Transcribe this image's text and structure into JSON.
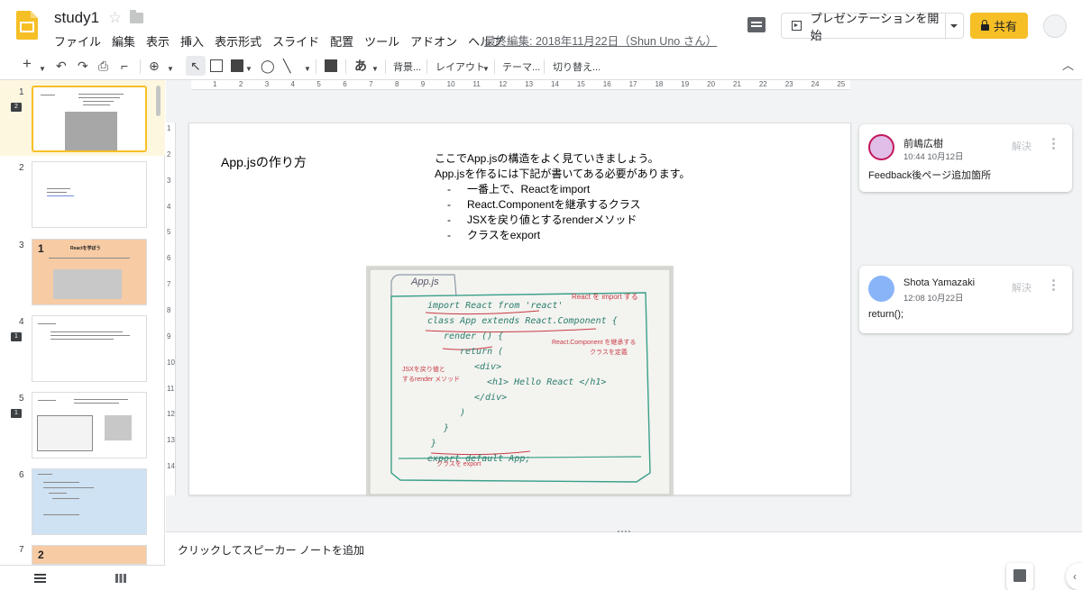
{
  "header": {
    "doc_title": "study1",
    "menu": [
      "ファイル",
      "編集",
      "表示",
      "挿入",
      "表示形式",
      "スライド",
      "配置",
      "ツール",
      "アドオン",
      "ヘルプ"
    ],
    "last_edit": "最終編集: 2018年11月22日（Shun Uno さん）",
    "present_label": "プレゼンテーションを開始",
    "share_label": "共有",
    "accent_color": "#f6bf26"
  },
  "toolbar": {
    "background_label": "背景...",
    "layout_label": "レイアウト",
    "theme_label": "テーマ...",
    "transition_label": "切り替え...",
    "text_style_glyph": "あ"
  },
  "filmstrip": {
    "slides": [
      {
        "num": "1",
        "comments": "2",
        "style": "white"
      },
      {
        "num": "2",
        "comments": "",
        "style": "white"
      },
      {
        "num": "3",
        "comments": "",
        "style": "orange"
      },
      {
        "num": "4",
        "comments": "1",
        "style": "white"
      },
      {
        "num": "5",
        "comments": "1",
        "style": "white"
      },
      {
        "num": "6",
        "comments": "",
        "style": "blue"
      },
      {
        "num": "7",
        "comments": "",
        "style": "orange"
      }
    ],
    "thumb_3_number": "1",
    "thumb_3_title": "Reactを学ぼう",
    "thumb_7_number": "2"
  },
  "ruler": {
    "h_ticks": [
      "1",
      "2",
      "3",
      "4",
      "5",
      "6",
      "7",
      "8",
      "9",
      "10",
      "11",
      "12",
      "13",
      "14",
      "15",
      "16",
      "17",
      "18",
      "19",
      "20",
      "21",
      "22",
      "23",
      "24",
      "25"
    ],
    "v_ticks": [
      "1",
      "2",
      "3",
      "4",
      "5",
      "6",
      "7",
      "8",
      "9",
      "10",
      "11",
      "12",
      "13",
      "14"
    ]
  },
  "slide": {
    "title": "App.jsの作り方",
    "intro_1": "ここでApp.jsの構造をよく見ていきましょう。",
    "intro_2": "App.jsを作るには下記が書いてある必要があります。",
    "bullets": [
      "一番上で、Reactをimport",
      "React.Componentを継承するクラス",
      "JSXを戻り値とするrenderメソッド",
      "クラスをexport"
    ],
    "whiteboard": {
      "tab": "App.js",
      "lines": [
        "import React from 'react'",
        "class App extends React.Component {",
        "render () {",
        "return (",
        "<div>",
        "<h1> Hello React </h1>",
        "</div>",
        ")",
        "}",
        "}",
        "export default App;"
      ],
      "notes": [
        "React を import する",
        "React.Component を継承する",
        "クラスを定義",
        "JSXを戻り値と",
        "するrender メソッド",
        "クラスを export"
      ]
    }
  },
  "comments": [
    {
      "name": "前嶋広樹",
      "time": "10:44 10月12日",
      "resolve": "解決",
      "text": "Feedback後ページ追加箇所"
    },
    {
      "name": "Shota Yamazaki",
      "time": "12:08 10月22日",
      "resolve": "解決",
      "text": "return();"
    }
  ],
  "notes": {
    "placeholder": "クリックしてスピーカー ノートを追加"
  }
}
